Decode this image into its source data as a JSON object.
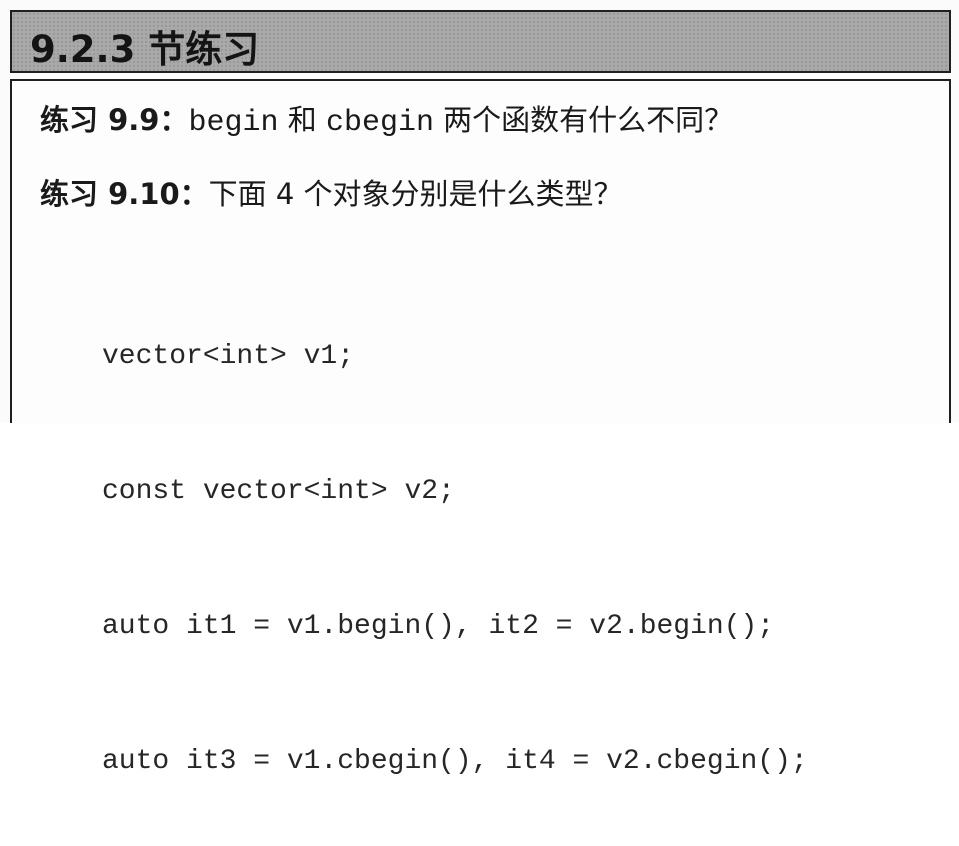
{
  "section": {
    "title": "9.2.3 节练习"
  },
  "exercises": [
    {
      "label": "练习 9.9：",
      "parts": [
        {
          "text": "begin",
          "code": true
        },
        {
          "text": " 和 ",
          "code": false
        },
        {
          "text": "cbegin",
          "code": true
        },
        {
          "text": " 两个函数有什么不同？",
          "code": false
        }
      ]
    },
    {
      "label": "练习 9.10：",
      "text": "下面 4 个对象分别是什么类型？"
    }
  ],
  "code_lines": [
    "vector<int> v1;",
    "const vector<int> v2;",
    "auto it1 = v1.begin(), it2 = v2.begin();",
    "auto it3 = v1.cbegin(), it4 = v2.cbegin();"
  ]
}
